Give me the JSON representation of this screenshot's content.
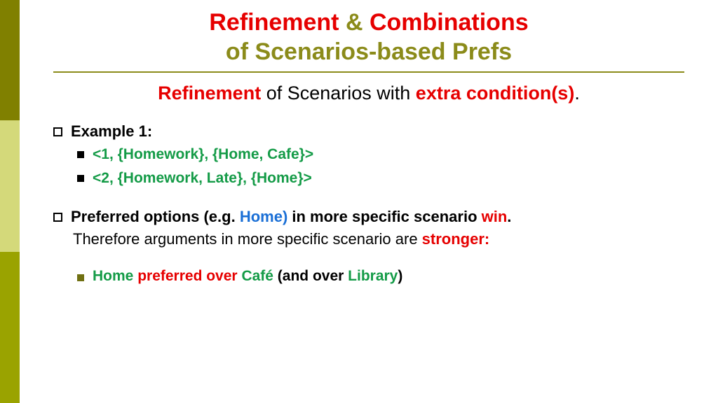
{
  "title": {
    "word1": "Refinement",
    "amp": "&",
    "word2": "Combinations",
    "line2": "of Scenarios-based Prefs"
  },
  "subheading": {
    "word1": "Refinement",
    "middle": " of Scenarios with ",
    "word2": "extra condition(s)",
    "period": "."
  },
  "example_label": "Example 1:",
  "tuples": {
    "t1": "<1, {Homework}, {Home, Cafe}>",
    "t2": "<2, {Homework, Late}, {Home}>"
  },
  "preferred_line": {
    "p1": "Preferred options (e.g. ",
    "home": "Home)",
    "p2": " in more specific scenario ",
    "win": "win",
    "p3": "."
  },
  "therefore_line": {
    "p1": "Therefore arguments in more specific scenario are ",
    "stronger": "stronger:"
  },
  "result_line": {
    "home": "Home",
    "pref": " preferred over ",
    "cafe": "Café",
    "andover": " (and over ",
    "library": "Library",
    "close": ")"
  }
}
